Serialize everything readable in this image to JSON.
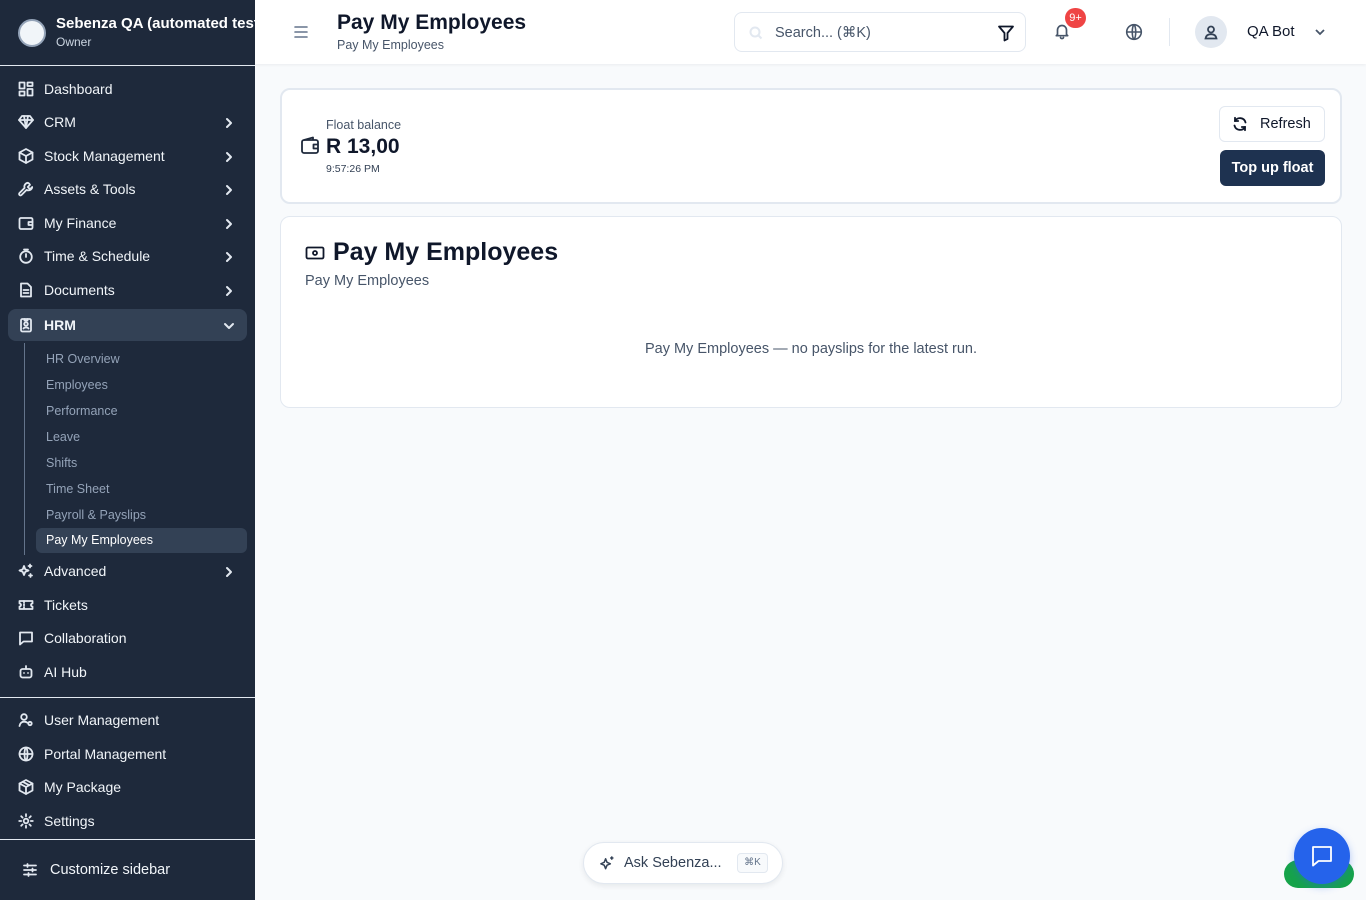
{
  "org": {
    "name": "Sebenza QA (automated tests)",
    "role": "Owner"
  },
  "sidebar": {
    "items": [
      {
        "label": "Dashboard",
        "icon": "dashboard-icon"
      },
      {
        "label": "CRM",
        "icon": "gem-icon"
      },
      {
        "label": "Stock Management",
        "icon": "box-icon"
      },
      {
        "label": "Assets & Tools",
        "icon": "wrench-icon"
      },
      {
        "label": "My Finance",
        "icon": "wallet-icon"
      },
      {
        "label": "Time & Schedule",
        "icon": "timer-icon"
      },
      {
        "label": "Documents",
        "icon": "document-icon"
      },
      {
        "label": "HRM",
        "icon": "id-badge-icon"
      }
    ],
    "hrm_sub": [
      "HR Overview",
      "Employees",
      "Performance",
      "Leave",
      "Shifts",
      "Time Sheet",
      "Payroll & Payslips",
      "Pay My Employees"
    ],
    "more_items": [
      {
        "label": "Advanced",
        "icon": "sparkles-icon"
      },
      {
        "label": "Tickets",
        "icon": "ticket-icon"
      },
      {
        "label": "Collaboration",
        "icon": "chat-icon"
      },
      {
        "label": "AI Hub",
        "icon": "bot-icon"
      }
    ],
    "bottom_items": [
      {
        "label": "User Management",
        "icon": "user-cog-icon"
      },
      {
        "label": "Portal Management",
        "icon": "globe-icon"
      },
      {
        "label": "My Package",
        "icon": "package-icon"
      },
      {
        "label": "Settings",
        "icon": "gear-icon"
      }
    ],
    "customize": "Customize sidebar"
  },
  "header": {
    "title": "Pay My Employees",
    "subtitle": "Pay My Employees",
    "search_placeholder": "Search... (⌘K)",
    "notification_badge": "9+",
    "user_name": "QA Bot"
  },
  "float": {
    "label": "Float balance",
    "amount": "R 13,00",
    "time": "9:57:26 PM",
    "refresh_label": "Refresh",
    "topup_label": "Top up float"
  },
  "pay": {
    "title": "Pay My Employees",
    "subtitle": "Pay My Employees",
    "empty_message": "Pay My Employees — no payslips for the latest run."
  },
  "assistant": {
    "label": "Ask Sebenza...",
    "shortcut": "⌘K"
  },
  "colors": {
    "sidebar_bg": "#1e293b",
    "primary_button": "#1e3250",
    "chat_button": "#2563eb",
    "badge": "#ef4444"
  }
}
